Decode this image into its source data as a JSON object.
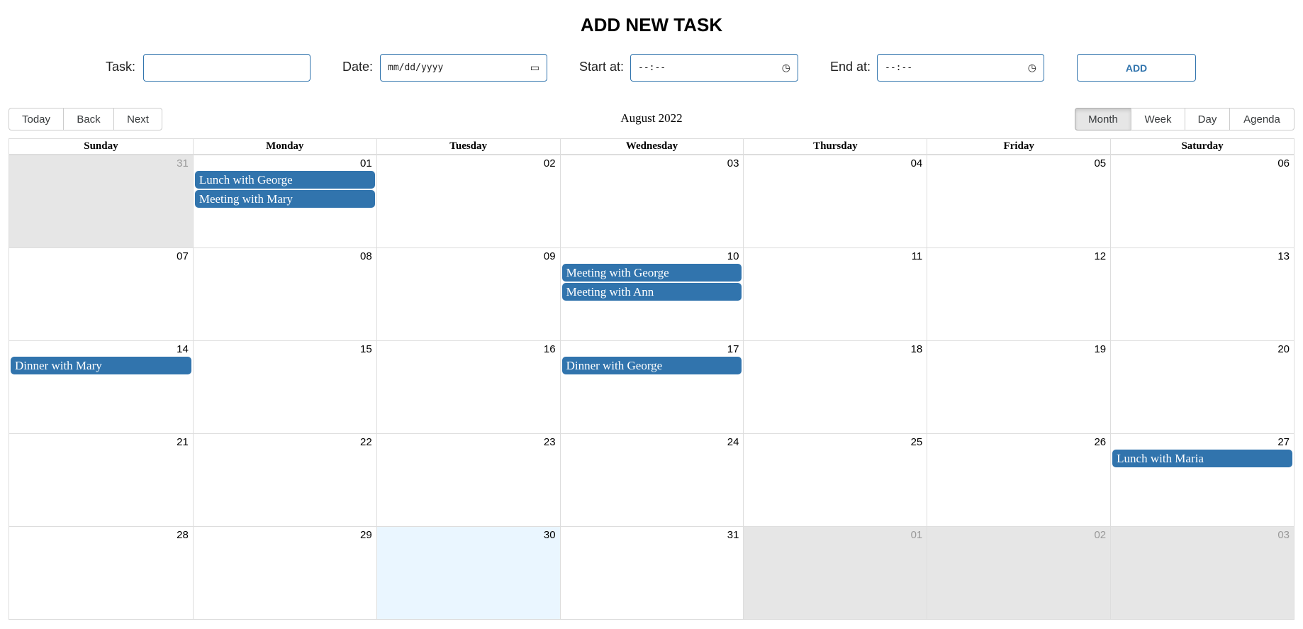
{
  "form": {
    "title": "ADD NEW TASK",
    "task_label": "Task:",
    "task_value": "",
    "date_label": "Date:",
    "date_placeholder": "mm/dd/yyyy",
    "start_label": "Start at:",
    "start_placeholder": "--:--",
    "end_label": "End at:",
    "end_placeholder": "--:--",
    "add_label": "ADD"
  },
  "toolbar": {
    "nav": [
      "Today",
      "Back",
      "Next"
    ],
    "label": "August 2022",
    "views": [
      "Month",
      "Week",
      "Day",
      "Agenda"
    ],
    "active_view": "Month"
  },
  "calendar": {
    "weekdays": [
      "Sunday",
      "Monday",
      "Tuesday",
      "Wednesday",
      "Thursday",
      "Friday",
      "Saturday"
    ],
    "weeks": [
      [
        {
          "d": "31",
          "off": true
        },
        {
          "d": "01",
          "events": [
            "Lunch with George",
            "Meeting with Mary"
          ]
        },
        {
          "d": "02"
        },
        {
          "d": "03"
        },
        {
          "d": "04"
        },
        {
          "d": "05"
        },
        {
          "d": "06"
        }
      ],
      [
        {
          "d": "07"
        },
        {
          "d": "08"
        },
        {
          "d": "09"
        },
        {
          "d": "10",
          "events": [
            "Meeting with George",
            "Meeting with Ann"
          ]
        },
        {
          "d": "11"
        },
        {
          "d": "12"
        },
        {
          "d": "13"
        }
      ],
      [
        {
          "d": "14",
          "events": [
            "Dinner with Mary"
          ]
        },
        {
          "d": "15"
        },
        {
          "d": "16"
        },
        {
          "d": "17",
          "events": [
            "Dinner with George"
          ]
        },
        {
          "d": "18"
        },
        {
          "d": "19"
        },
        {
          "d": "20"
        }
      ],
      [
        {
          "d": "21"
        },
        {
          "d": "22"
        },
        {
          "d": "23"
        },
        {
          "d": "24"
        },
        {
          "d": "25"
        },
        {
          "d": "26"
        },
        {
          "d": "27",
          "events": [
            "Lunch with Maria"
          ]
        }
      ],
      [
        {
          "d": "28"
        },
        {
          "d": "29"
        },
        {
          "d": "30",
          "today": true
        },
        {
          "d": "31"
        },
        {
          "d": "01",
          "off": true
        },
        {
          "d": "02",
          "off": true
        },
        {
          "d": "03",
          "off": true
        }
      ]
    ],
    "colors": {
      "event": "#3174ad",
      "off_range": "#e6e6e6",
      "today": "#eaf6ff"
    }
  }
}
